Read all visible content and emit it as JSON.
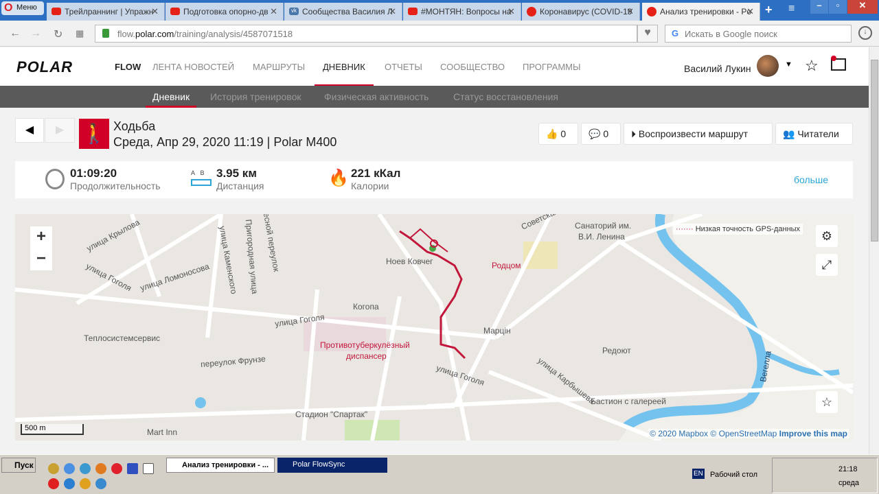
{
  "browser": {
    "menu_label": "Меню",
    "tabs": [
      {
        "title": "Трейлраннинг | Упражн",
        "icon": "youtube-icon"
      },
      {
        "title": "Подготовка опорно-дв",
        "icon": "youtube-icon"
      },
      {
        "title": "Сообщества Василия Л",
        "icon": "vk-icon"
      },
      {
        "title": "#МОНТЯН: Вопросы на",
        "icon": "youtube-icon"
      },
      {
        "title": "Коронавирус (COVID-19",
        "icon": "opera-icon"
      },
      {
        "title": "Анализ тренировки - Po",
        "icon": "opera-icon"
      }
    ],
    "url_prefix": "flow.",
    "url_domain": "polar.com",
    "url_path": "/training/analysis/4587071518",
    "search_placeholder": "Искать в Google поиск"
  },
  "header": {
    "logo": "POLAR",
    "flow": "FLOW",
    "nav": [
      "ЛЕНТА НОВОСТЕЙ",
      "МАРШРУТЫ",
      "ДНЕВНИК",
      "ОТЧЕТЫ",
      "СООБЩЕСТВО",
      "ПРОГРАММЫ"
    ],
    "active_nav": "ДНЕВНИК",
    "user": "Василий Лукин"
  },
  "subnav": {
    "items": [
      "Дневник",
      "История тренировок",
      "Физическая активность",
      "Статус восстановления"
    ],
    "active": "Дневник"
  },
  "training": {
    "sport": "Ходьба",
    "date_device": "Среда, Апр 29, 2020 11:19 | Polar M400",
    "likes": "0",
    "comments": "0",
    "replay_label": "Воспроизвести маршрут",
    "readers_label": "Читатели"
  },
  "stats": {
    "duration": "01:09:20",
    "duration_label": "Продолжительность",
    "ab_a": "A",
    "ab_b": "B",
    "distance": "3.95 км",
    "distance_label": "Дистанция",
    "calories": "221 кКал",
    "calories_label": "Калории",
    "more": "больше"
  },
  "map": {
    "gps_legend": "Низкая точность GPS-данных",
    "scale": "500 m",
    "attribution_1": "© 2020 Mapbox",
    "attribution_2": "© OpenStreetMap",
    "attribution_3": "Improve this map",
    "labels": [
      "улица Крылова",
      "улица Каменского",
      "Пригородная улица",
      "Лесной переулок",
      "улица Ломоносова",
      "улица Гоголя",
      "улица Гоголя",
      "Ноев Ковчег",
      "Родцом",
      "Советская",
      "Санаторий им.",
      "В.И. Ленина",
      "Когопа",
      "Марцін",
      "Теплосистемсервис",
      "переулок Фрунзе",
      "Противотуберкулёзный",
      "диспансер",
      "улица Гоголя",
      "Редоют",
      "улица Карбышева",
      "Бастион с галереей",
      "Стадион \"Спартак\"",
      "Mart Inn",
      "Вегелла"
    ]
  },
  "taskbar": {
    "start": "Пуск",
    "windows": [
      "Анализ тренировки - ...",
      "Polar FlowSync"
    ],
    "lang": "EN",
    "desktop": "Рабочий стол",
    "time": "21:18",
    "day": "среда"
  }
}
